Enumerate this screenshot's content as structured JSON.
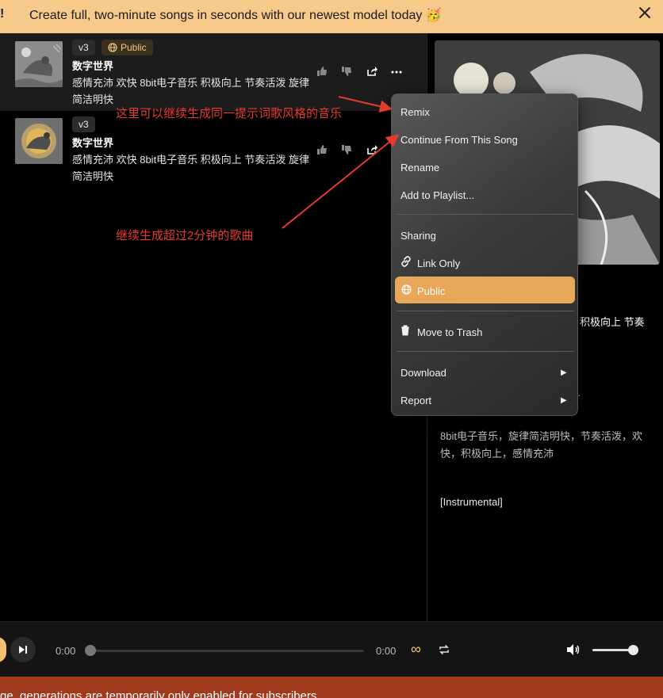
{
  "banner": {
    "bang": "!",
    "text": "Create full, two-minute songs in seconds with our newest model today 🥳"
  },
  "songs": [
    {
      "version": "v3",
      "visibility": "Public",
      "title": "数字世界",
      "desc": "感情充沛 欢快 8bit电子音乐 积极向上 节奏活泼 旋律简洁明快"
    },
    {
      "version": "v3",
      "title": "数字世界",
      "desc": "感情充沛 欢快 8bit电子音乐 积极向上 节奏活泼 旋律简洁明快"
    }
  ],
  "menu": {
    "remix": "Remix",
    "continue": "Continue From This Song",
    "rename": "Rename",
    "add_playlist": "Add to Playlist...",
    "sharing": "Sharing",
    "link_only": "Link Only",
    "public": "Public",
    "trash": "Move to Trash",
    "download": "Download",
    "report": "Report"
  },
  "annotations": {
    "a1": "这里可以继续生成同一提示词歌风格的音乐",
    "a2": "继续生成超过2分钟的歌曲"
  },
  "right": {
    "partial_tags": "积极向上 节奏",
    "dots": "..",
    "style": "8bit电子音乐，旋律简洁明快，节奏活泼，欢快，积极向上，感情充沛",
    "lyrics": "[Instrumental]"
  },
  "player": {
    "current": "0:00",
    "duration": "0:00",
    "progress": 0,
    "volume": 0.85
  },
  "notice": "ge, generations are temporarily only enabled for subscribers",
  "colors": {
    "accent": "#e9a75a",
    "banner": "#f7c98b",
    "notice": "#a03a1c"
  }
}
